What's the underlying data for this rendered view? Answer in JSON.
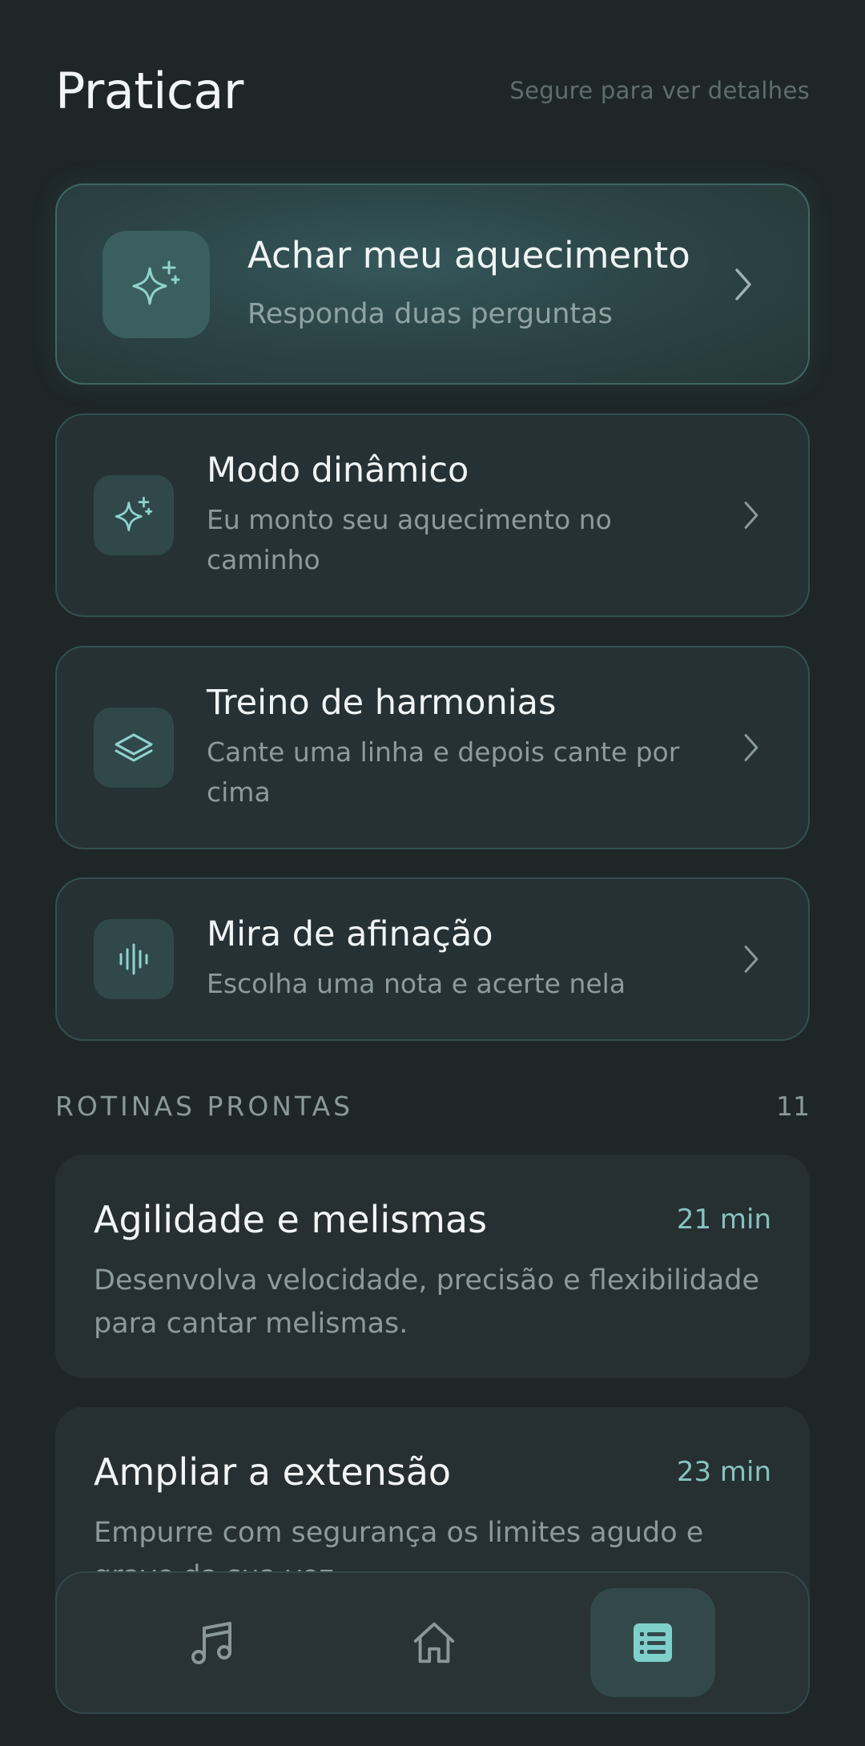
{
  "header": {
    "title": "Praticar",
    "hint": "Segure para ver detalhes"
  },
  "hero": {
    "icon": "sparkles-icon",
    "title": "Achar meu aquecimento",
    "subtitle": "Responda duas perguntas"
  },
  "modes": [
    {
      "icon": "sparkles-icon",
      "title": "Modo dinâmico",
      "subtitle": "Eu monto seu aquecimento no caminho"
    },
    {
      "icon": "layers-icon",
      "title": "Treino de harmonias",
      "subtitle": "Cante uma linha e depois cante por cima"
    },
    {
      "icon": "waveform-icon",
      "title": "Mira de afinação",
      "subtitle": "Escolha uma nota e acerte nela"
    }
  ],
  "routines_section": {
    "title": "ROTINAS PRONTAS",
    "count": "11"
  },
  "routines": [
    {
      "title": "Agilidade e melismas",
      "duration": "21 min",
      "description": "Desenvolva velocidade, precisão e flexibilidade para cantar melismas."
    },
    {
      "title": "Ampliar a extensão",
      "duration": "23 min",
      "description": "Empurre com segurança os limites agudo e grave da sua voz."
    }
  ],
  "nav": {
    "items": [
      {
        "icon": "music-note-icon",
        "active": false
      },
      {
        "icon": "home-icon",
        "active": false
      },
      {
        "icon": "list-icon",
        "active": true
      }
    ]
  },
  "colors": {
    "background": "#1e2628",
    "card": "#253134",
    "accent": "#86c3bf",
    "border": "#34504f"
  }
}
